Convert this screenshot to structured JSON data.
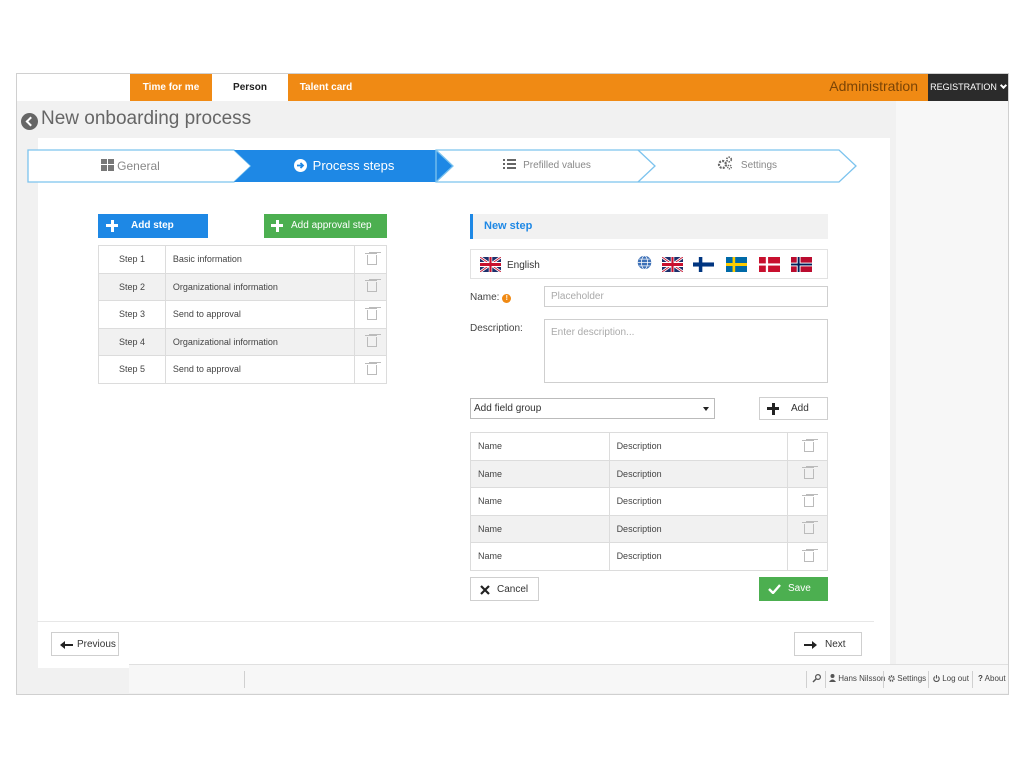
{
  "topnav": {
    "tabs": [
      {
        "label": "Time for me"
      },
      {
        "label": "Person"
      },
      {
        "label": "Talent card"
      }
    ],
    "admin_label": "Administration",
    "registration_label": "REGISTRATION"
  },
  "page": {
    "title": "New onboarding process"
  },
  "wizard": {
    "steps": [
      {
        "label": "General",
        "icon": "grid-icon"
      },
      {
        "label": "Process steps",
        "icon": "arrow-circle-right-icon"
      },
      {
        "label": "Prefilled values",
        "icon": "list-icon"
      },
      {
        "label": "Settings",
        "icon": "gears-icon"
      }
    ],
    "active_index": 1
  },
  "left": {
    "add_step_label": "Add step",
    "add_approval_label": "Add approval step",
    "steps": [
      {
        "num": "Step 1",
        "name": "Basic information"
      },
      {
        "num": "Step 2",
        "name": "Organizational information"
      },
      {
        "num": "Step 3",
        "name": "Send to approval"
      },
      {
        "num": "Step 4",
        "name": "Organizational information"
      },
      {
        "num": "Step 5",
        "name": "Send to approval"
      }
    ]
  },
  "form": {
    "header": "New step",
    "language": "English",
    "flags": [
      "globe-icon",
      "uk-flag-icon",
      "finland-flag-icon",
      "sweden-flag-icon",
      "denmark-flag-icon",
      "norway-flag-icon"
    ],
    "name_label": "Name:",
    "name_placeholder": "Placeholder",
    "description_label": "Description:",
    "description_placeholder": "Enter description...",
    "field_group_selected": "Add field group",
    "add_label": "Add",
    "groups": [
      {
        "name": "Name",
        "description": "Description"
      },
      {
        "name": "Name",
        "description": "Description"
      },
      {
        "name": "Name",
        "description": "Description"
      },
      {
        "name": "Name",
        "description": "Description"
      },
      {
        "name": "Name",
        "description": "Description"
      }
    ],
    "cancel_label": "Cancel",
    "save_label": "Save"
  },
  "nav": {
    "previous_label": "Previous",
    "next_label": "Next"
  },
  "footer": {
    "user": "Hans Nilsson",
    "settings": "Settings",
    "logout": "Log out",
    "about": "About"
  },
  "colors": {
    "brand_orange": "#f08a14",
    "primary_blue": "#1e88e5",
    "success_green": "#4caf50"
  }
}
